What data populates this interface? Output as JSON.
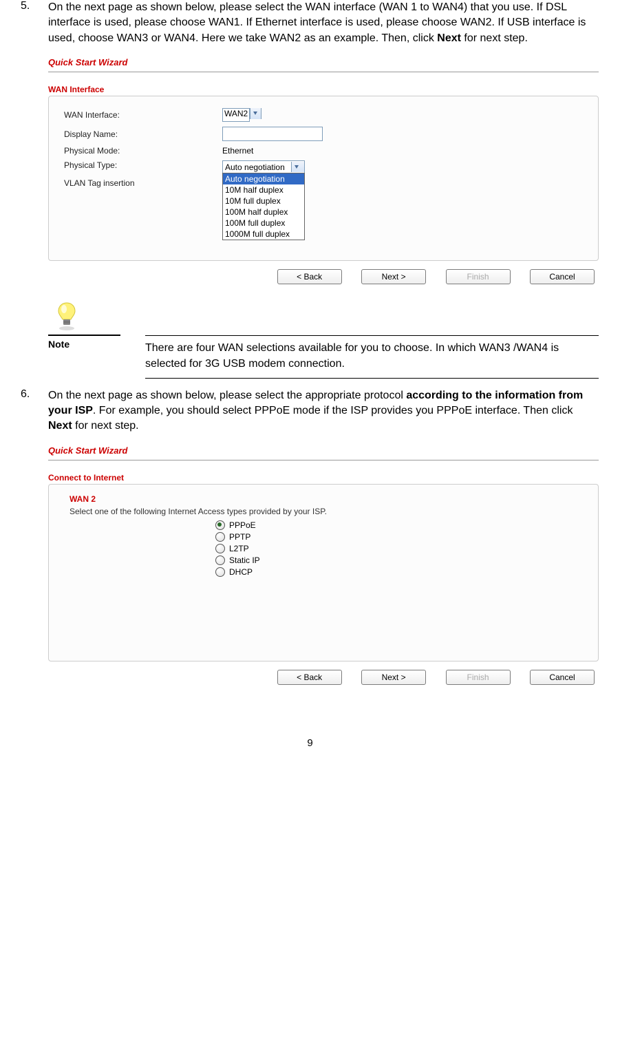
{
  "step5": {
    "num": "5.",
    "text_parts": {
      "a": "On the next page as shown below, please select the WAN interface (WAN 1 to WAN4) that you use. If DSL interface is used, please choose WAN1. If Ethernet interface is used, please choose WAN2. If USB interface is used, choose WAN3 or WAN4. Here we take WAN2 as an example. Then, click ",
      "b": "Next",
      "c": " for next step."
    }
  },
  "wizard1": {
    "title": "Quick Start Wizard",
    "section": "WAN Interface",
    "fields": {
      "wan_interface_label": "WAN Interface:",
      "wan_interface_value": "WAN2",
      "display_name_label": "Display Name:",
      "display_name_value": "",
      "physical_mode_label": "Physical Mode:",
      "physical_mode_value": "Ethernet",
      "physical_type_label": "Physical Type:",
      "physical_type_selected": "Auto negotiation",
      "vlan_label": "VLAN Tag insertion"
    },
    "physical_type_options": [
      "Auto negotiation",
      "10M half duplex",
      "10M full duplex",
      "100M half duplex",
      "100M full duplex",
      "1000M full duplex"
    ],
    "buttons": {
      "back": "< Back",
      "next": "Next >",
      "finish": "Finish",
      "cancel": "Cancel"
    }
  },
  "note": {
    "label": "Note",
    "body": "There are four WAN selections available for you to choose. In which WAN3 /WAN4 is selected for 3G USB modem connection."
  },
  "step6": {
    "num": "6.",
    "text_parts": {
      "a": "On the next page as shown below, please select the appropriate protocol ",
      "b": "according to the information from your ISP",
      "c": ". For example, you should select PPPoE mode if the ISP provides you PPPoE interface. Then click ",
      "d": "Next",
      "e": " for next step."
    }
  },
  "wizard2": {
    "title": "Quick Start Wizard",
    "section": "Connect to Internet",
    "wan_heading": "WAN 2",
    "instruction": "Select one of the following Internet Access types provided by your ISP.",
    "options": [
      {
        "label": "PPPoE",
        "checked": true
      },
      {
        "label": "PPTP",
        "checked": false
      },
      {
        "label": "L2TP",
        "checked": false
      },
      {
        "label": "Static IP",
        "checked": false
      },
      {
        "label": "DHCP",
        "checked": false
      }
    ],
    "buttons": {
      "back": "< Back",
      "next": "Next >",
      "finish": "Finish",
      "cancel": "Cancel"
    }
  },
  "page_number": "9"
}
